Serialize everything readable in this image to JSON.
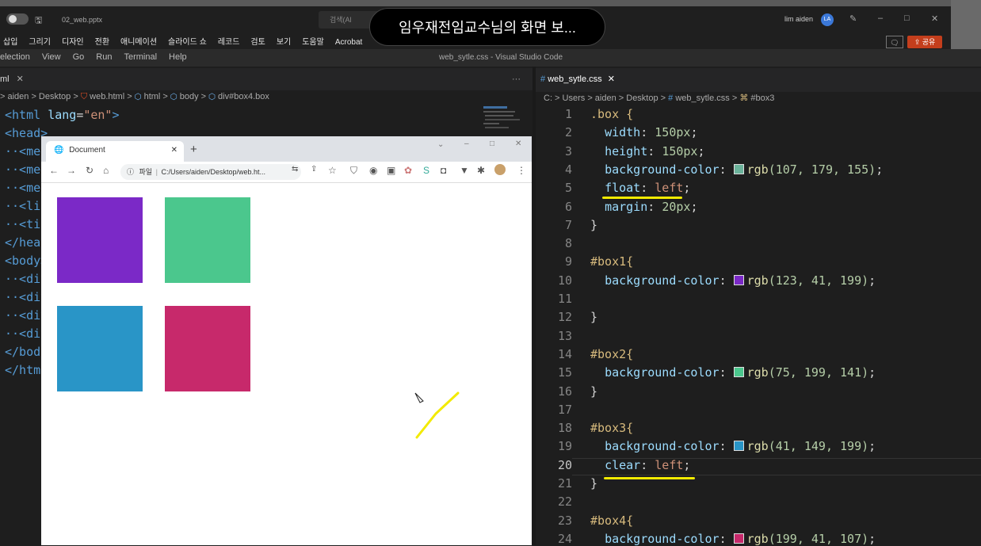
{
  "ppt": {
    "filename": "02_web.pptx",
    "search": "검색(Al",
    "user_name": "lim aiden",
    "avatar": "LA",
    "ribbon": [
      "삽입",
      "그리기",
      "디자인",
      "전환",
      "애니메이션",
      "슬라이드 쇼",
      "레코드",
      "검토",
      "보기",
      "도움말",
      "Acrobat"
    ],
    "share": "공유",
    "controls": {
      "minimize": "–",
      "maximize": "□",
      "close": "✕"
    }
  },
  "share_banner": "임우재전임교수님의 화면 보...",
  "vscode": {
    "menu": [
      "election",
      "View",
      "Go",
      "Run",
      "Terminal",
      "Help"
    ],
    "title": "web_sytle.css - Visual Studio Code",
    "more": "···",
    "left_tab": "ml",
    "left_breadcrumb": "> aiden > Desktop > ",
    "left_crumbs": [
      "web.html",
      "html",
      "body",
      "div#box4.box"
    ],
    "left_code": [
      {
        "a": "<html ",
        "b": "lang",
        "c": "=",
        "d": "\"en\"",
        "e": ">"
      },
      {
        "a": "<head>",
        "b": "",
        "c": "",
        "d": "",
        "e": ""
      },
      {
        "a": "··<met",
        "b": "",
        "c": "",
        "d": "",
        "e": ""
      },
      {
        "a": "··<met",
        "b": "",
        "c": "",
        "d": "",
        "e": ""
      },
      {
        "a": "··<met",
        "b": "",
        "c": "",
        "d": "",
        "e": ""
      },
      {
        "a": "··<lin",
        "b": "",
        "c": "",
        "d": "",
        "e": ""
      },
      {
        "a": "··<tit",
        "b": "",
        "c": "",
        "d": "",
        "e": ""
      },
      {
        "a": "</head",
        "b": "",
        "c": "",
        "d": "",
        "e": ""
      },
      {
        "a": "<body>",
        "b": "",
        "c": "",
        "d": "",
        "e": ""
      },
      {
        "a": "··<div",
        "b": "",
        "c": "",
        "d": "",
        "e": ""
      },
      {
        "a": "··<div",
        "b": "",
        "c": "",
        "d": "",
        "e": ""
      },
      {
        "a": "··<div",
        "b": "",
        "c": "",
        "d": "",
        "e": ""
      },
      {
        "a": "··<div",
        "b": "",
        "c": "",
        "d": "",
        "e": ""
      },
      {
        "a": "</body",
        "b": "",
        "c": "",
        "d": "",
        "e": ""
      },
      {
        "a": "</htm",
        "b": "",
        "c": "",
        "d": "",
        "e": ""
      }
    ],
    "right_tab": "web_sytle.css",
    "right_breadcrumb": "C: > Users > aiden > Desktop > ",
    "right_crumbs": [
      "web_sytle.css",
      "#box3"
    ],
    "css_lines": [
      {
        "n": "1",
        "t": ".box {"
      },
      {
        "n": "2",
        "p": "width",
        "v": "150px;"
      },
      {
        "n": "3",
        "p": "height",
        "v": "150px;"
      },
      {
        "n": "4",
        "p": "background-color",
        "c": "#6bb39b",
        "v": "rgb(107, 179, 155);"
      },
      {
        "n": "5",
        "p": "float",
        "v": "left;"
      },
      {
        "n": "6",
        "p": "margin",
        "v": "20px;"
      },
      {
        "n": "7",
        "t": "}"
      },
      {
        "n": "8",
        "t": ""
      },
      {
        "n": "9",
        "t": "#box1{"
      },
      {
        "n": "10",
        "p": "background-color",
        "c": "#7b29c7",
        "v": "rgb(123, 41, 199);"
      },
      {
        "n": "11",
        "t": ""
      },
      {
        "n": "12",
        "t": "}"
      },
      {
        "n": "13",
        "t": ""
      },
      {
        "n": "14",
        "t": "#box2{"
      },
      {
        "n": "15",
        "p": "background-color",
        "c": "#4bc78d",
        "v": "rgb(75, 199, 141);"
      },
      {
        "n": "16",
        "t": "}"
      },
      {
        "n": "17",
        "t": ""
      },
      {
        "n": "18",
        "t": "#box3{"
      },
      {
        "n": "19",
        "p": "background-color",
        "c": "#2995c7",
        "v": "rgb(41, 149, 199);"
      },
      {
        "n": "20",
        "p": "clear",
        "v": "left;"
      },
      {
        "n": "21",
        "t": "}"
      },
      {
        "n": "22",
        "t": ""
      },
      {
        "n": "23",
        "t": "#box4{"
      },
      {
        "n": "24",
        "p": "background-color",
        "c": "#c7296b",
        "v": "rgb(199, 41, 107);"
      }
    ]
  },
  "browser": {
    "tab_title": "Document",
    "new_tab": "+",
    "url_label": "파일",
    "url": "C:/Users/aiden/Desktop/web.ht...",
    "boxes": [
      {
        "id": "box1",
        "color": "#7b29c7"
      },
      {
        "id": "box2",
        "color": "#4bc78d"
      },
      {
        "id": "box3",
        "color": "#2995c7"
      },
      {
        "id": "box4",
        "color": "#c7296b"
      }
    ]
  }
}
